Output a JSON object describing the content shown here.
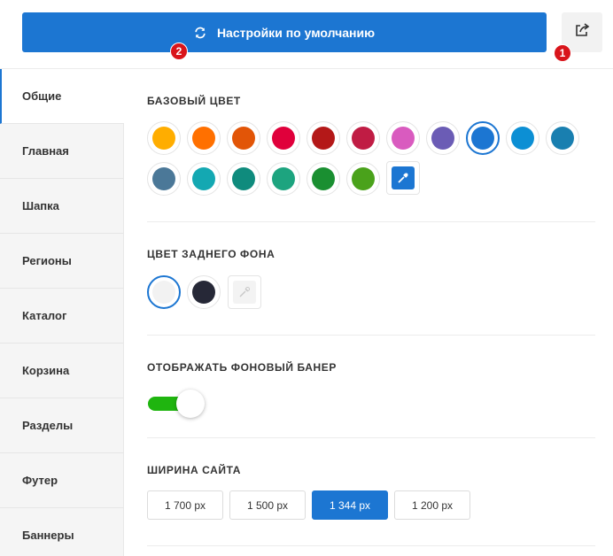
{
  "header": {
    "reset_label": "Настройки по умолчанию",
    "reset_icon": "refresh-icon",
    "share_icon": "share-icon",
    "badge_1": "1",
    "badge_2": "2",
    "accent": "#1c76d2",
    "badge_color": "#d9151b"
  },
  "sidebar": {
    "items": [
      {
        "label": "Общие",
        "active": true
      },
      {
        "label": "Главная"
      },
      {
        "label": "Шапка"
      },
      {
        "label": "Регионы"
      },
      {
        "label": "Каталог"
      },
      {
        "label": "Корзина"
      },
      {
        "label": "Разделы"
      },
      {
        "label": "Футер"
      },
      {
        "label": "Баннеры"
      }
    ]
  },
  "base_color": {
    "title": "Базовый цвет",
    "colors": [
      "#ffad00",
      "#ff7000",
      "#e25507",
      "#e0003b",
      "#b41818",
      "#c01c44",
      "#d95bbf",
      "#6b5cb5",
      "#1c76d2",
      "#0c8fd4",
      "#197fb0",
      "#4b7898",
      "#14a8b2",
      "#0f8b7d",
      "#1da47f",
      "#1a8f31",
      "#4aa21b"
    ],
    "selected_index": 8,
    "picker_icon": "eyedropper-icon"
  },
  "bg_color": {
    "title": "Цвет заднего фона",
    "colors": [
      "#f2f2f2",
      "#262837"
    ],
    "selected_index": 0,
    "picker_icon": "eyedropper-icon"
  },
  "banner": {
    "title": "Отображать фоновый банер",
    "enabled": true,
    "on_color": "#1fb50f"
  },
  "site_width": {
    "title": "Ширина сайта",
    "options": [
      "1 700 px",
      "1 500 px",
      "1 344 px",
      "1 200 px"
    ],
    "selected_index": 2
  }
}
